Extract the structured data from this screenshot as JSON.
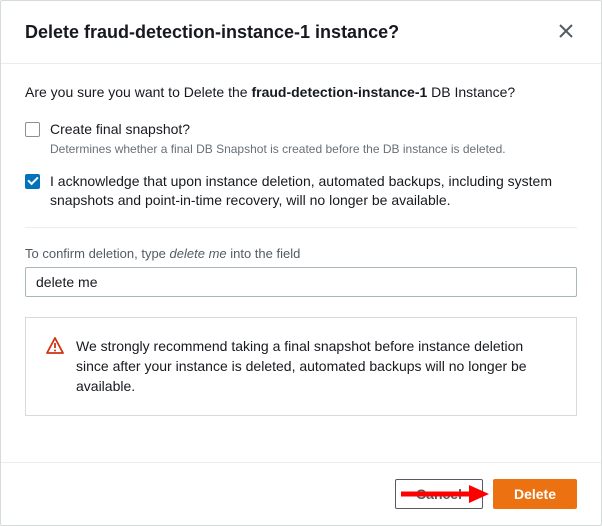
{
  "modal": {
    "title": "Delete fraud-detection-instance-1 instance?",
    "confirm_prefix": "Are you sure you want to Delete the ",
    "confirm_instance": "fraud-detection-instance-1",
    "confirm_suffix": " DB Instance?"
  },
  "options": {
    "snapshot": {
      "label": "Create final snapshot?",
      "help": "Determines whether a final DB Snapshot is created before the DB instance is deleted.",
      "checked": false
    },
    "acknowledge": {
      "label": "I acknowledge that upon instance deletion, automated backups, including system snapshots and point-in-time recovery, will no longer be available.",
      "checked": true
    }
  },
  "confirm_field": {
    "label_prefix": "To confirm deletion, type ",
    "label_phrase": "delete me",
    "label_suffix": " into the field",
    "value": "delete me"
  },
  "alert": {
    "text": "We strongly recommend taking a final snapshot before instance deletion since after your instance is deleted, automated backups will no longer be available."
  },
  "footer": {
    "cancel_label": "Cancel",
    "delete_label": "Delete"
  },
  "colors": {
    "primary": "#ec7211",
    "checkbox_checked": "#0073bb",
    "warning": "#d13212"
  }
}
